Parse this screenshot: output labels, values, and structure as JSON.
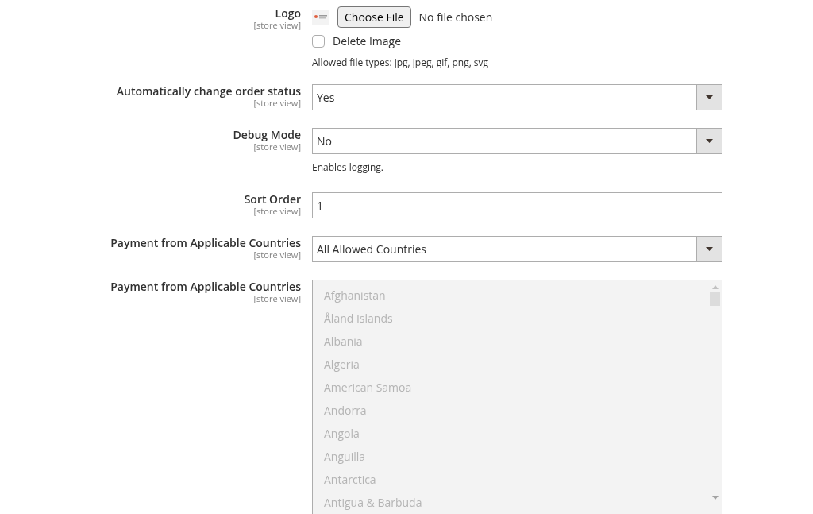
{
  "fields": [
    {
      "kind": "file",
      "label": "Logo",
      "scope": "[store view]",
      "button": "Choose File",
      "file_status": "No file chosen",
      "checkbox": {
        "label": "Delete Image",
        "checked": false
      },
      "note": "Allowed file types: jpg, jpeg, gif, png, svg"
    },
    {
      "kind": "select",
      "label": "Automatically change order status",
      "scope": "[store view]",
      "value": "Yes"
    },
    {
      "kind": "select",
      "label": "Debug Mode",
      "scope": "[store view]",
      "value": "No",
      "note": "Enables logging."
    },
    {
      "kind": "text",
      "label": "Sort Order",
      "scope": "[store view]",
      "value": "1"
    },
    {
      "kind": "select",
      "label": "Payment from Applicable Countries",
      "scope": "[store view]",
      "value": "All Allowed Countries"
    },
    {
      "kind": "multiselect",
      "label": "Payment from Applicable Countries",
      "scope": "[store view]",
      "disabled": true,
      "options": [
        "Afghanistan",
        "Åland Islands",
        "Albania",
        "Algeria",
        "American Samoa",
        "Andorra",
        "Angola",
        "Anguilla",
        "Antarctica",
        "Antigua & Barbuda"
      ]
    }
  ]
}
